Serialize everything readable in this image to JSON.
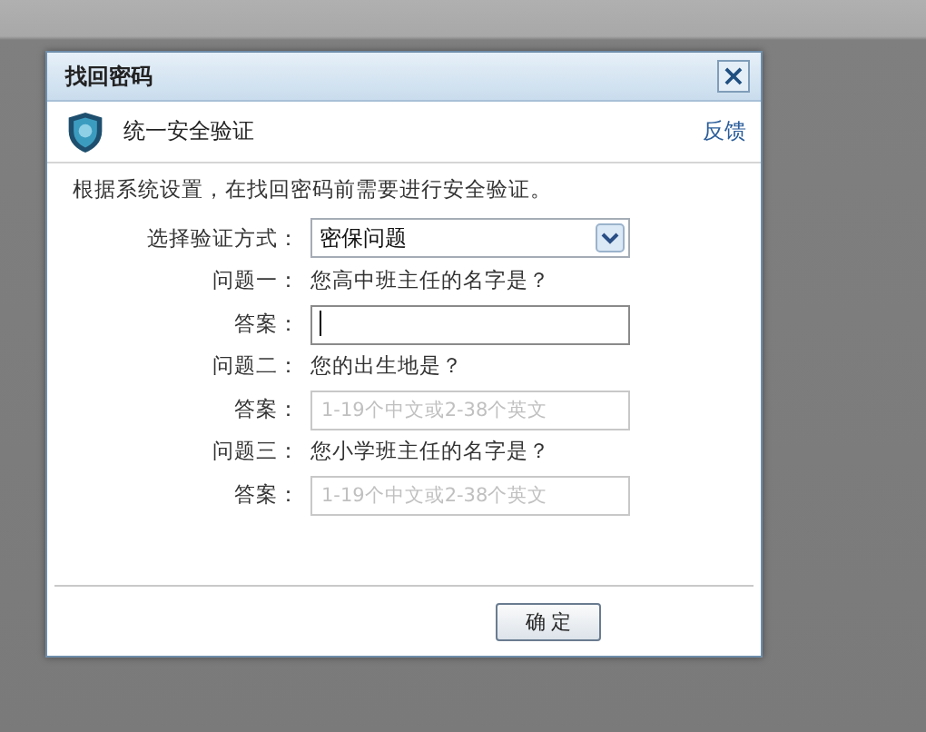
{
  "dialog": {
    "title": "找回密码",
    "close": "×"
  },
  "header": {
    "title": "统一安全验证",
    "link": "反馈"
  },
  "intro": "根据系统设置，在找回密码前需要进行安全验证。",
  "method": {
    "label": "选择验证方式：",
    "value": "密保问题"
  },
  "questions": [
    {
      "label": "问题一：",
      "text": "您高中班主任的名字是？",
      "answer_label": "答案：",
      "focused": true
    },
    {
      "label": "问题二：",
      "text": "您的出生地是？",
      "answer_label": "答案：",
      "placeholder": "1-19个中文或2-38个英文",
      "focused": false
    },
    {
      "label": "问题三：",
      "text": "您小学班主任的名字是？",
      "answer_label": "答案：",
      "placeholder": "1-19个中文或2-38个英文",
      "focused": false
    }
  ],
  "buttons": [
    "确 定"
  ]
}
